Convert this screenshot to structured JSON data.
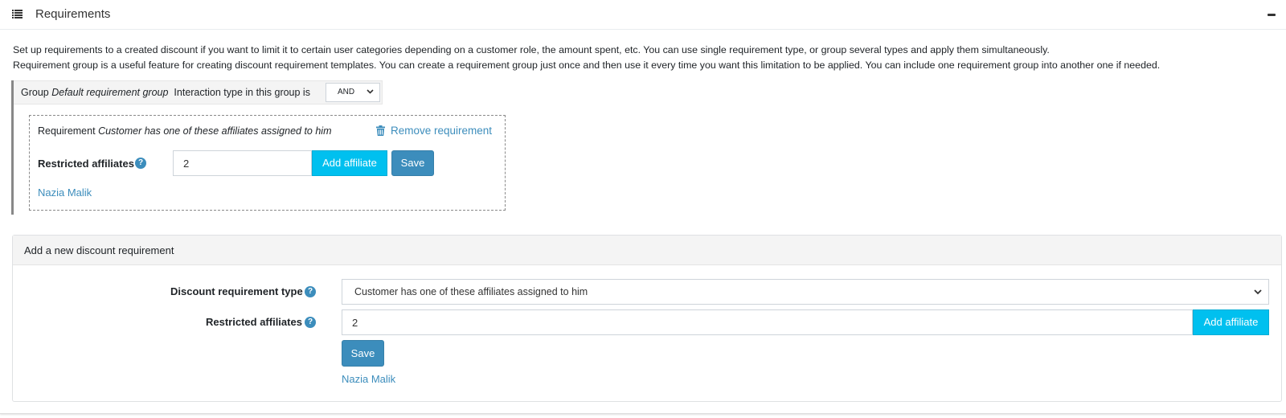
{
  "header": {
    "title": "Requirements",
    "icon": "list-icon",
    "collapse_icon": "minus-icon"
  },
  "description": {
    "line1": "Set up requirements to a created discount if you want to limit it to certain user categories depending on a customer role, the amount spent, etc. You can use single requirement type, or group several types and apply them simultaneously.",
    "line2": "Requirement group is a useful feature for creating discount requirement templates. You can create a requirement group just once and then use it every time you want this limitation to be applied. You can include one requirement group into another one if needed."
  },
  "group": {
    "prefix": "Group",
    "name": "Default requirement group",
    "interaction_label": "Interaction type in this group is",
    "interaction_value": "AND",
    "requirement": {
      "prefix": "Requirement",
      "name": "Customer has one of these affiliates assigned to him",
      "remove_label": "Remove requirement",
      "field_label": "Restricted affiliates",
      "input_value": "2",
      "add_button": "Add affiliate",
      "save_button": "Save",
      "affiliate_link": "Nazia Malik"
    }
  },
  "add_new": {
    "title": "Add a new discount requirement",
    "type_label": "Discount requirement type",
    "type_value": "Customer has one of these affiliates assigned to him",
    "affiliates_label": "Restricted affiliates",
    "input_value": "2",
    "add_button": "Add affiliate",
    "save_button": "Save",
    "affiliate_link": "Nazia Malik"
  },
  "colors": {
    "accent_blue": "#3c8dbc",
    "accent_cyan": "#00c0ef"
  }
}
